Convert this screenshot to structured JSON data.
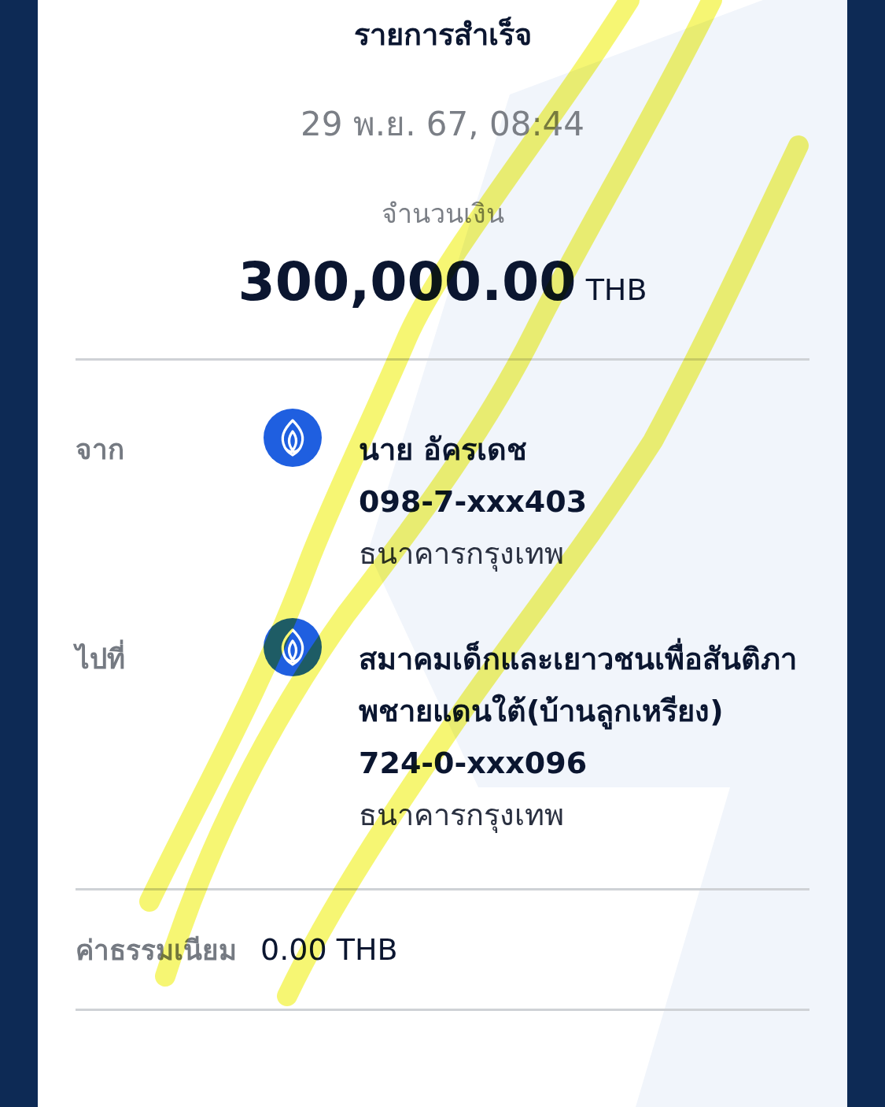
{
  "title": "รายการสำเร็จ",
  "datetime": "29 พ.ย. 67, 08:44",
  "amount_label": "จำนวนเงิน",
  "amount": "300,000.00",
  "currency": "THB",
  "parties": [
    {
      "label": "จาก",
      "name": "นาย อัครเดช",
      "account": "098-7-xxx403",
      "bank": "ธนาคารกรุงเทพ"
    },
    {
      "label": "ไปที่",
      "name": "สมาคมเด็กและเยาวชนเพื่อสันติภาพชายแดนใต้(บ้านลูกเหรียง)",
      "account": "724-0-xxx096",
      "bank": "ธนาคารกรุงเทพ"
    }
  ],
  "fee": {
    "label": "ค่าธรรมเนียม",
    "value": "0.00 THB"
  }
}
